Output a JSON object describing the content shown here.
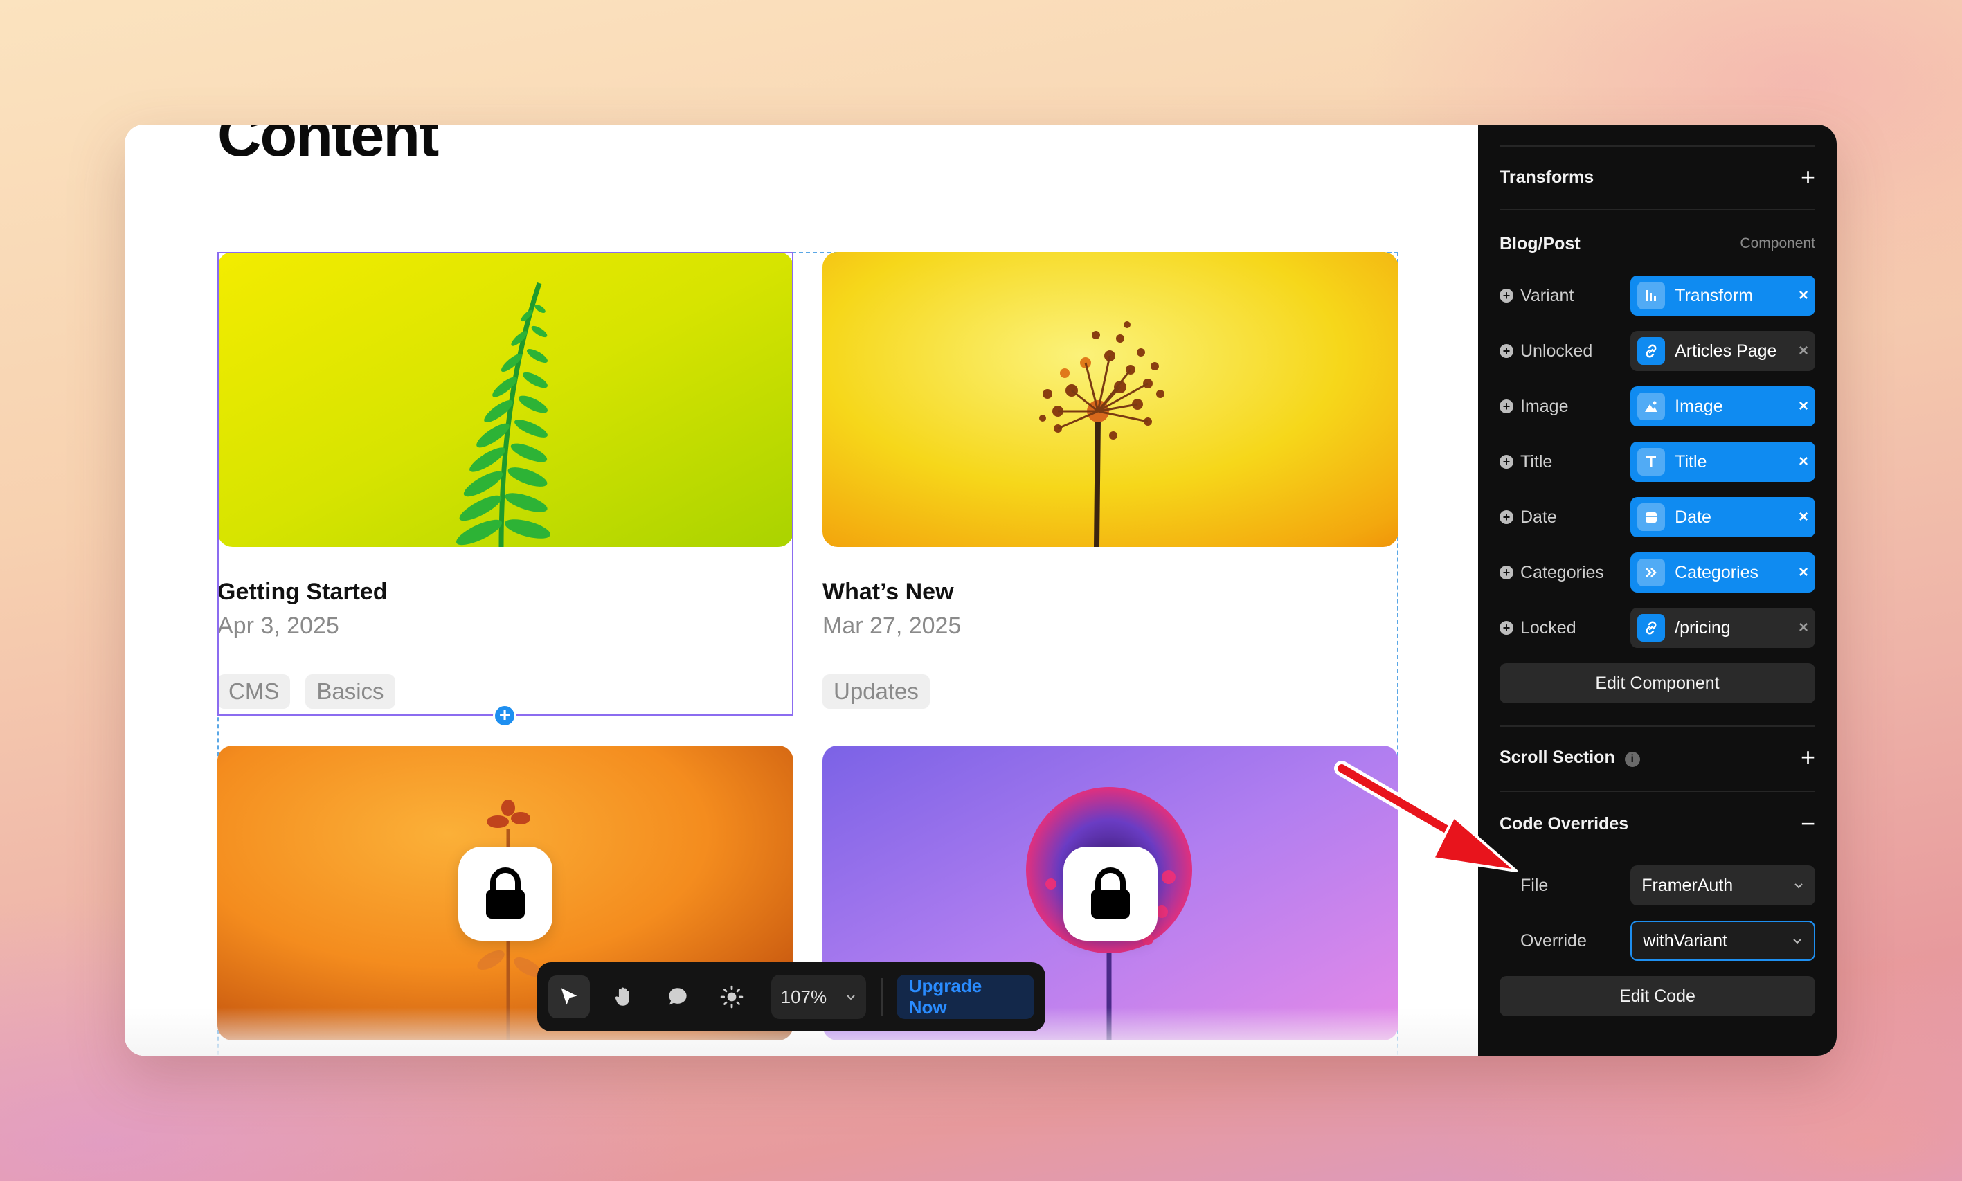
{
  "canvas": {
    "page_title": "Content",
    "cards": [
      {
        "title": "Getting Started",
        "date": "Apr 3, 2025",
        "tags": [
          "CMS",
          "Basics"
        ],
        "locked": false
      },
      {
        "title": "What’s New",
        "date": "Mar 27, 2025",
        "tags": [
          "Updates"
        ],
        "locked": false
      },
      {
        "locked": true
      },
      {
        "locked": true
      }
    ]
  },
  "toolbar": {
    "zoom": "107%",
    "upgrade_label": "Upgrade Now",
    "tools": [
      "select-icon",
      "hand-icon",
      "comment-icon",
      "brightness-icon"
    ]
  },
  "panel": {
    "transforms": {
      "title": "Transforms"
    },
    "component": {
      "title": "Blog/Post",
      "subtitle": "Component",
      "props": [
        {
          "label": "Variant",
          "value": "Transform",
          "icon": "variant-icon",
          "style": "blue"
        },
        {
          "label": "Unlocked",
          "value": "Articles Page",
          "icon": "link-icon",
          "style": "dark"
        },
        {
          "label": "Image",
          "value": "Image",
          "icon": "image-icon",
          "style": "blue"
        },
        {
          "label": "Title",
          "value": "Title",
          "icon": "text-icon",
          "style": "blue"
        },
        {
          "label": "Date",
          "value": "Date",
          "icon": "date-icon",
          "style": "blue"
        },
        {
          "label": "Categories",
          "value": "Categories",
          "icon": "categories-icon",
          "style": "blue"
        },
        {
          "label": "Locked",
          "value": "/pricing",
          "icon": "link-icon",
          "style": "dark"
        }
      ],
      "edit_button": "Edit Component"
    },
    "scroll_section": {
      "title": "Scroll Section"
    },
    "code_overrides": {
      "title": "Code Overrides",
      "file_label": "File",
      "file_value": "FramerAuth",
      "override_label": "Override",
      "override_value": "withVariant",
      "edit_button": "Edit Code"
    }
  },
  "colors": {
    "accent": "#0f8bf1",
    "panel_bg": "#0f0f0f",
    "selection": "#8b6cf0",
    "arrow": "#e8141c"
  }
}
